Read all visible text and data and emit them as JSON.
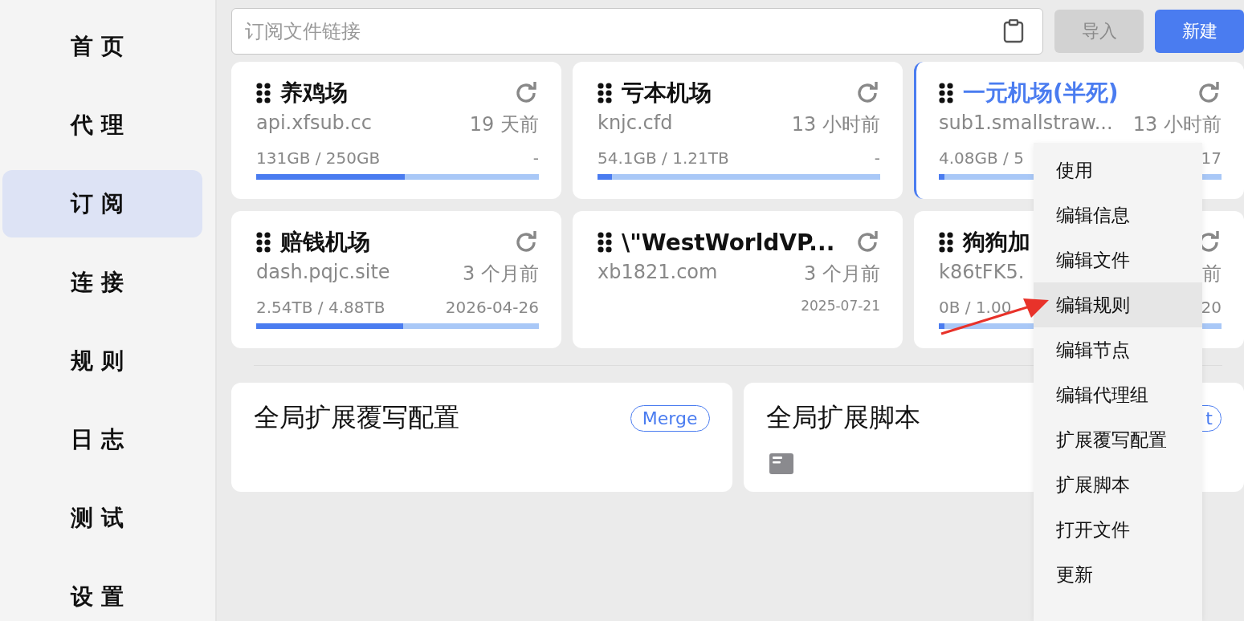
{
  "sidebar": {
    "items": [
      {
        "label": "首 页",
        "selected": false
      },
      {
        "label": "代 理",
        "selected": false
      },
      {
        "label": "订 阅",
        "selected": true
      },
      {
        "label": "连 接",
        "selected": false
      },
      {
        "label": "规 则",
        "selected": false
      },
      {
        "label": "日 志",
        "selected": false
      },
      {
        "label": "测 试",
        "selected": false
      },
      {
        "label": "设 置",
        "selected": false
      }
    ]
  },
  "subscription_field": {
    "placeholder": "订阅文件链接"
  },
  "buttons": [
    {
      "label": "导入",
      "disabled": true
    },
    {
      "label": "新建",
      "disabled": false
    }
  ],
  "profiles": [
    {
      "title": "养鸡场",
      "url": "api.xfsub.cc",
      "updated": "19 天前",
      "usage": "131GB / 250GB",
      "expire": "-",
      "level": 0.525,
      "selected": false
    },
    {
      "title": "亏本机场",
      "url": "knjc.cfd",
      "updated": "13 小时前",
      "usage": "54.1GB / 1.21TB",
      "expire": "-",
      "level": 0.05,
      "selected": false
    },
    {
      "title": "一元机场(半死)",
      "url": "sub1.smallstraw...",
      "updated": "13 小时前",
      "usage": "4.08GB / 5",
      "expire": "17",
      "level": 0.02,
      "selected": true
    },
    {
      "title": "赔钱机场",
      "url": "dash.pqjc.site",
      "updated": "3 个月前",
      "usage": "2.54TB / 4.88TB",
      "expire": "2026-04-26",
      "level": 0.52,
      "selected": false
    },
    {
      "title": "\\\"WestWorldVP...",
      "url": "xb1821.com",
      "updated": "3 个月前",
      "expire": "2025-07-21",
      "selected": false
    },
    {
      "title": "狗狗加",
      "url": "k86tFK5.",
      "updated": "前",
      "usage": "0B / 1.00",
      "expire": "20",
      "level": 0.02,
      "selected": false
    }
  ],
  "global_cards": [
    {
      "title": "全局扩展覆写配置",
      "badge": "Merge",
      "kind": "merge"
    },
    {
      "title": "全局扩展脚本",
      "badge": "t",
      "kind": "script"
    }
  ],
  "context_menu": {
    "items": [
      {
        "label": "使用",
        "selected": false
      },
      {
        "label": "编辑信息",
        "selected": false
      },
      {
        "label": "编辑文件",
        "selected": false
      },
      {
        "label": "编辑规则",
        "selected": true
      },
      {
        "label": "编辑节点",
        "selected": false
      },
      {
        "label": "编辑代理组",
        "selected": false
      },
      {
        "label": "扩展覆写配置",
        "selected": false
      },
      {
        "label": "扩展脚本",
        "selected": false
      },
      {
        "label": "打开文件",
        "selected": false
      },
      {
        "label": "更新",
        "selected": false
      }
    ]
  }
}
